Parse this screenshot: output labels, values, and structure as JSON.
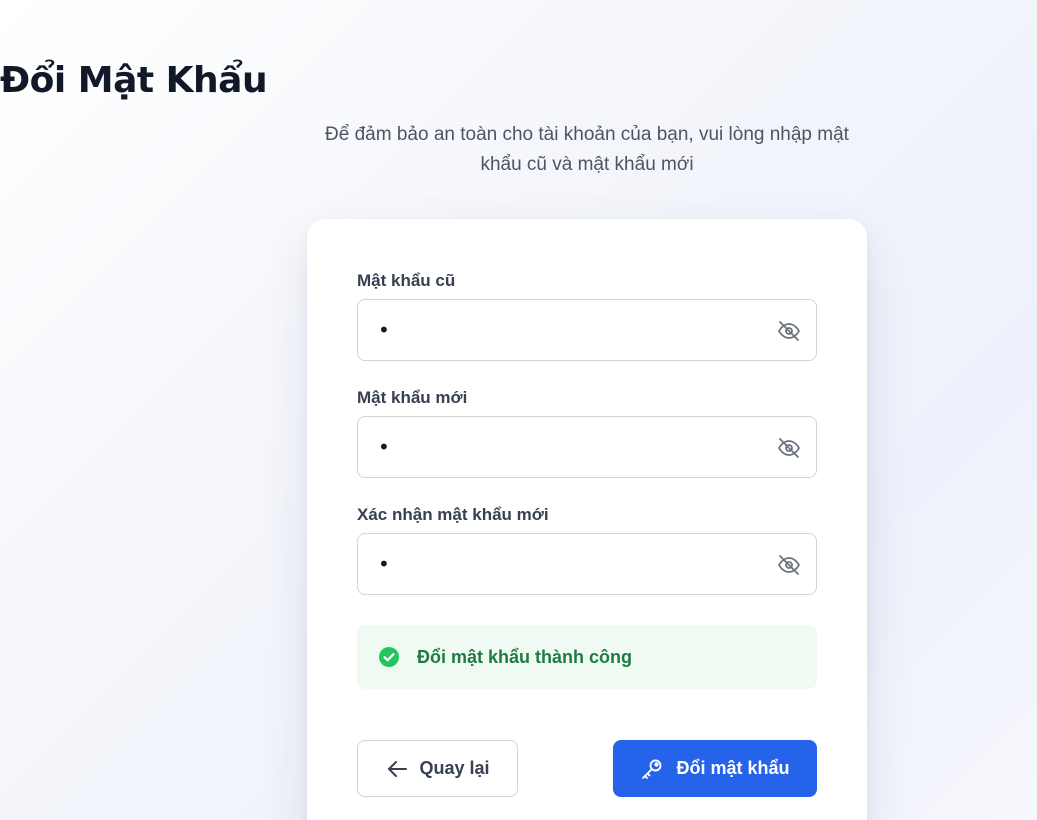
{
  "page": {
    "title": "Đổi Mật Khẩu",
    "subtitle": "Để đảm bảo an toàn cho tài khoản của bạn, vui lòng nhập mật khẩu cũ và mật khẩu mới"
  },
  "form": {
    "old_password": {
      "label": "Mật khẩu cũ",
      "value": "•",
      "icon": "eye-off-icon"
    },
    "new_password": {
      "label": "Mật khẩu mới",
      "value": "•",
      "icon": "eye-off-icon"
    },
    "confirm_password": {
      "label": "Xác nhận mật khẩu mới",
      "value": "•",
      "icon": "eye-off-icon"
    }
  },
  "alert": {
    "text": "Đổi mật khẩu thành công",
    "icon": "check-circle-icon",
    "color": "#22c55e"
  },
  "actions": {
    "back_label": "Quay lại",
    "back_icon": "arrow-left-icon",
    "submit_label": "Đổi mật khẩu",
    "submit_icon": "key-icon",
    "accent": "#2563eb"
  }
}
